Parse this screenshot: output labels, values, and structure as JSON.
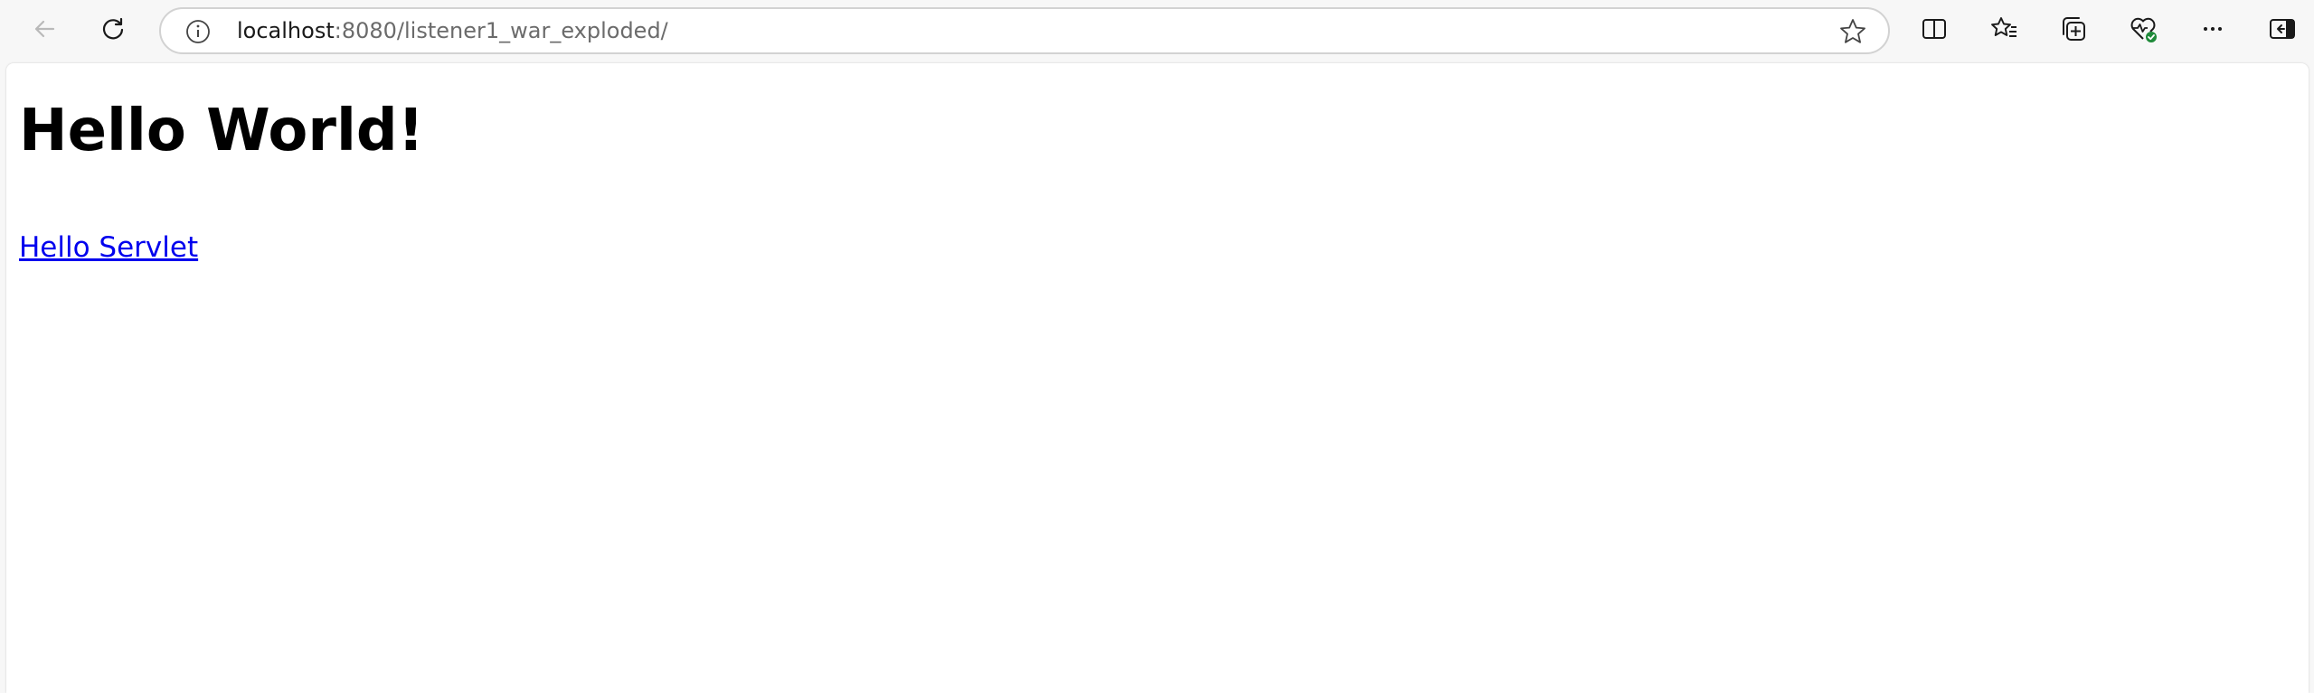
{
  "browser": {
    "url_host": "localhost",
    "url_path": ":8080/listener1_war_exploded/",
    "icons": {
      "back": "back-arrow-icon",
      "refresh": "refresh-icon",
      "info": "info-icon",
      "favorite": "star-icon",
      "split_screen": "split-screen-icon",
      "favorites": "favorites-list-icon",
      "collections": "collections-icon",
      "browser_essentials": "heart-pulse-icon",
      "more": "more-icon",
      "sidebar": "sidebar-toggle-icon"
    },
    "colors": {
      "essentials_badge": "#1f8a3a",
      "link": "#0000ee"
    }
  },
  "page": {
    "heading": "Hello World!",
    "link_text": "Hello Servlet"
  }
}
